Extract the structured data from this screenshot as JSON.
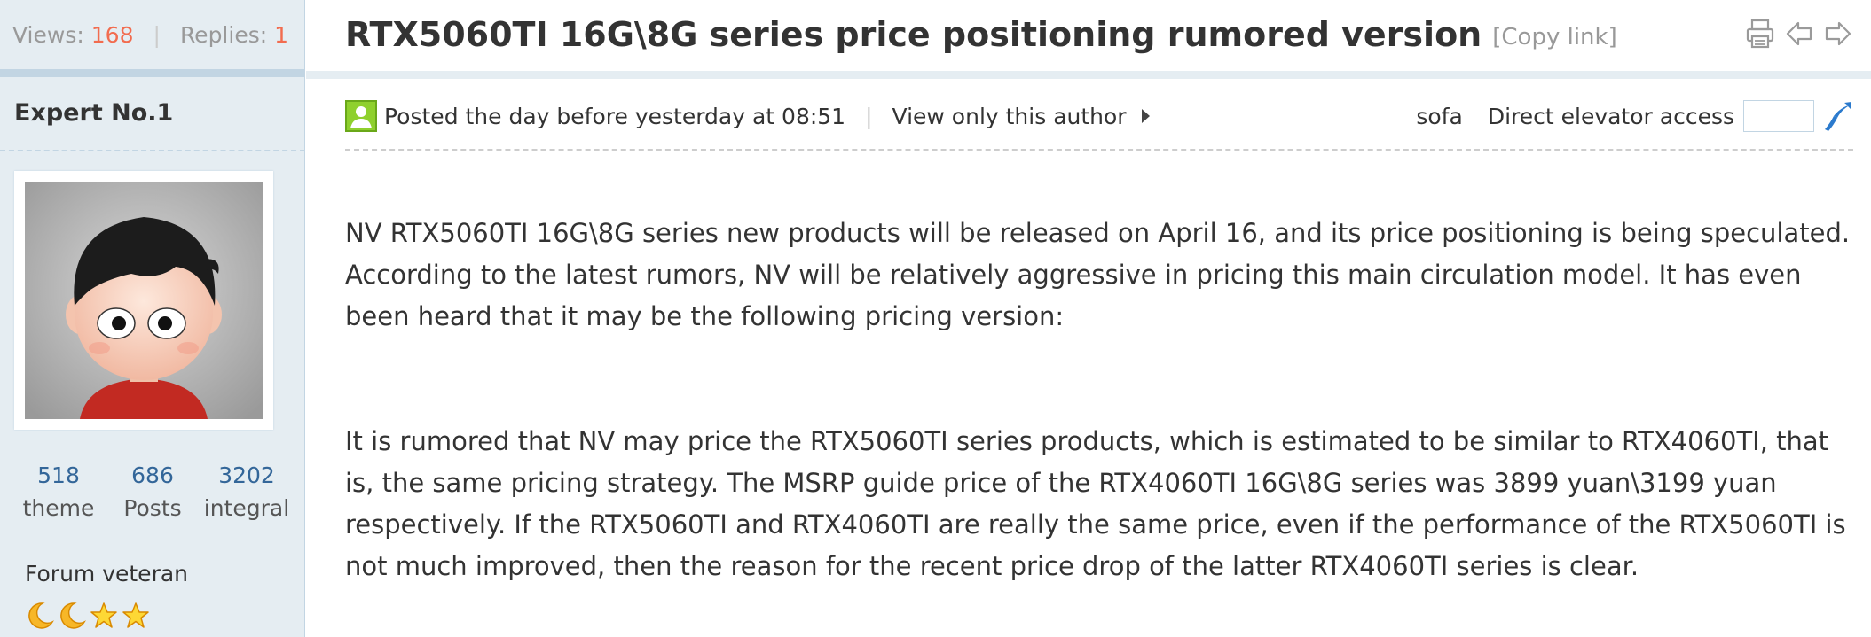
{
  "thread": {
    "title": "RTX5060TI 16G\\8G series price positioning rumored version",
    "copy_link": "[Copy link]",
    "views_label": "Views:",
    "views": "168",
    "separator": "|",
    "replies_label": "Replies:",
    "replies": "1"
  },
  "toolbar": {
    "icons": [
      "print-icon",
      "previous-thread-icon",
      "next-thread-icon"
    ]
  },
  "author": {
    "name": "Expert No.1",
    "stats": [
      {
        "value": "518",
        "label": "theme"
      },
      {
        "value": "686",
        "label": "Posts"
      },
      {
        "value": "3202",
        "label": "integral"
      }
    ],
    "rank_title": "Forum veteran",
    "rank_icons": [
      "moon-icon",
      "moon-icon",
      "star-icon",
      "star-icon"
    ]
  },
  "post_meta": {
    "posted": "Posted the day before yesterday at 08:51",
    "separator": "|",
    "view_only_author": "View only this author",
    "floor": "sofa",
    "jump_label": "Direct elevator access",
    "jump_value": ""
  },
  "post": {
    "paragraphs": [
      "NV RTX5060TI 16G\\8G series new products will be released on April 16, and its price positioning is being speculated. According to the latest rumors, NV will be relatively aggressive in pricing this main circulation model. It has even been heard that it may be the following pricing version:",
      "It is rumored that NV may price the RTX5060TI series products, which is estimated to be similar to RTX4060TI, that is, the same pricing strategy. The MSRP guide price of the RTX4060TI 16G\\8G series was 3899 yuan\\3199 yuan respectively. If the RTX5060TI and RTX4060TI are really the same price, even if the performance of the RTX5060TI is not much improved, then the reason for the recent price drop of the latter RTX4060TI series is clear."
    ]
  },
  "colors": {
    "sidebar_bg": "#e5edf2",
    "border": "#c2d5e3",
    "number_accent": "#f26c4f",
    "stat_value": "#336699",
    "online_green": "#8fd02d",
    "jump_arrow": "#2b7acd"
  }
}
